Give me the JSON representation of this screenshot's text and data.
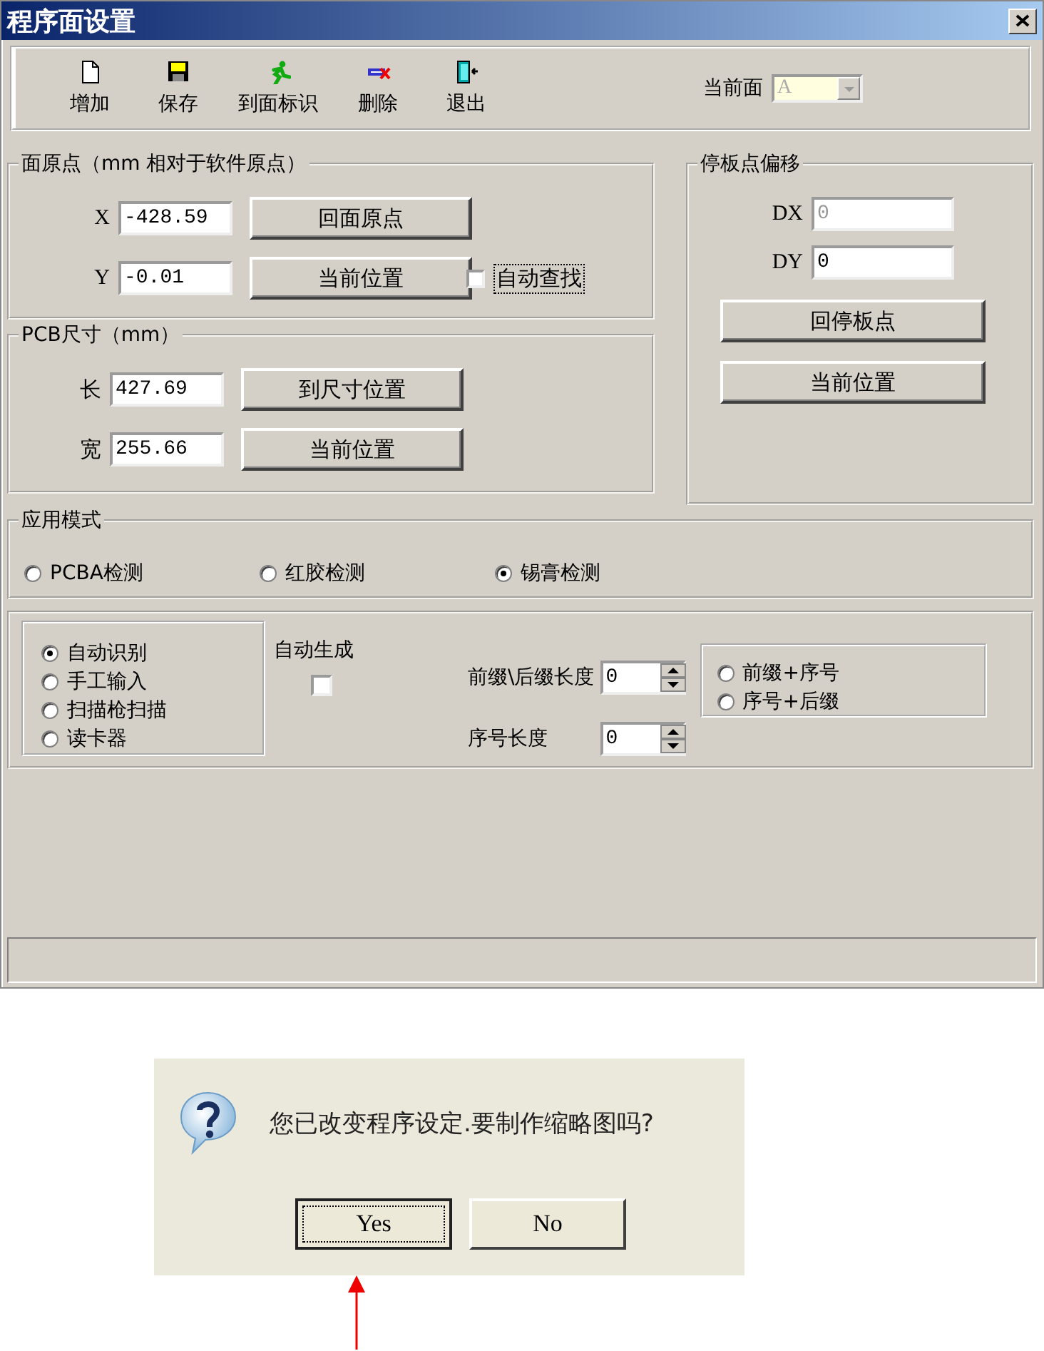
{
  "window": {
    "title": "程序面设置"
  },
  "toolbar": {
    "buttons": [
      {
        "kind": "new",
        "label": "增加"
      },
      {
        "kind": "save",
        "label": "保存"
      },
      {
        "kind": "goto",
        "label": "到面标识"
      },
      {
        "kind": "delete",
        "label": "删除"
      },
      {
        "kind": "exit",
        "label": "退出"
      }
    ],
    "current_face": {
      "label": "当前面",
      "value": "A",
      "disabled": true
    }
  },
  "origin": {
    "title": "面原点（mm 相对于软件原点）",
    "fields": [
      {
        "label": "X",
        "value": "-428.59",
        "button": "回面原点"
      },
      {
        "label": "Y",
        "value": "-0.01",
        "button": "当前位置"
      }
    ],
    "auto_find": {
      "label": "自动查找",
      "checked": false,
      "focused": true
    }
  },
  "pcb_size": {
    "title": "PCB尺寸（mm）",
    "fields": [
      {
        "label": "长",
        "value": "427.69",
        "button": "到尺寸位置"
      },
      {
        "label": "宽",
        "value": "255.66",
        "button": "当前位置"
      }
    ]
  },
  "stop_offset": {
    "title": "停板点偏移",
    "fields": [
      {
        "label": "DX",
        "value": "0",
        "disabled": true
      },
      {
        "label": "DY",
        "value": "0",
        "disabled": false
      }
    ],
    "buttons": [
      "回停板点",
      "当前位置"
    ]
  },
  "mode": {
    "title": "应用模式",
    "options": [
      {
        "label": "PCBA检测",
        "selected": false
      },
      {
        "label": "红胶检测",
        "selected": false
      },
      {
        "label": "锡膏检测",
        "selected": true
      }
    ]
  },
  "barcode": {
    "sources": [
      {
        "label": "自动识别",
        "selected": true
      },
      {
        "label": "手工输入",
        "selected": false
      },
      {
        "label": "扫描枪扫描",
        "selected": false
      },
      {
        "label": "读卡器",
        "selected": false
      }
    ],
    "auto_generate": {
      "label": "自动生成",
      "checked": false
    },
    "lengths": [
      {
        "label": "前缀\\后缀长度",
        "value": "0"
      },
      {
        "label": "序号长度",
        "value": "0"
      }
    ],
    "formats": [
      {
        "label": "前缀+序号",
        "selected": false
      },
      {
        "label": "序号+后缀",
        "selected": false
      }
    ]
  },
  "message_box": {
    "text": "您已改变程序设定.要制作缩略图吗?",
    "buttons": [
      {
        "label": "Yes",
        "focused": true
      },
      {
        "label": "No",
        "focused": false
      }
    ]
  }
}
